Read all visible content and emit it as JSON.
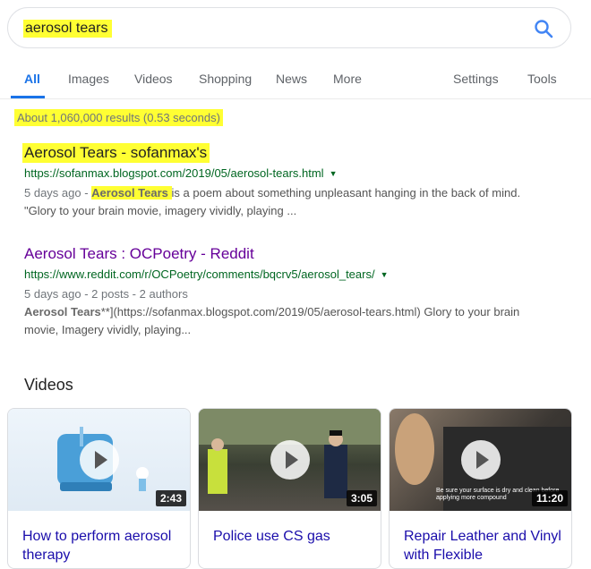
{
  "search": {
    "query": "aerosol tears"
  },
  "tabs": [
    {
      "label": "All"
    },
    {
      "label": "Images"
    },
    {
      "label": "Videos"
    },
    {
      "label": "Shopping"
    },
    {
      "label": "News"
    },
    {
      "label": "More"
    },
    {
      "label": "Settings"
    },
    {
      "label": "Tools"
    }
  ],
  "stats": "About 1,060,000 results (0.53 seconds)",
  "results": [
    {
      "title": "Aerosol Tears - sofanmax's",
      "url": "https://sofanmax.blogspot.com/2019/05/aerosol-tears.html",
      "meta": "5 days ago - ",
      "snippet_bold": "Aerosol Tears ",
      "snippet_rest": "is a poem about something unpleasant hanging in the back of mind.",
      "snippet_line2": "\"Glory to your brain movie, imagery vividly, playing ..."
    },
    {
      "title": "Aerosol Tears : OCPoetry - Reddit",
      "url": "https://www.reddit.com/r/OCPoetry/comments/bqcrv5/aerosol_tears/",
      "meta": "5 days ago - 2 posts - 2 authors",
      "snippet_bold": "Aerosol Tears",
      "snippet_rest": "**](https://sofanmax.blogspot.com/2019/05/aerosol-tears.html) Glory to your brain",
      "snippet_line2": "movie, Imagery vividly, playing..."
    }
  ],
  "videos": {
    "heading": "Videos",
    "items": [
      {
        "title": "How to perform aerosol therapy",
        "duration": "2:43"
      },
      {
        "title": "Police use CS gas",
        "duration": "3:05"
      },
      {
        "title": "Repair Leather and Vinyl with Flexible",
        "duration": "11:20",
        "overlay": "Be sure your surface is dry and clean before applying more compound"
      }
    ]
  },
  "colors": {
    "highlight": "#ffff33",
    "accent": "#1a73e8",
    "visited": "#660099",
    "url": "#006621",
    "video_link": "#1a0dab"
  }
}
